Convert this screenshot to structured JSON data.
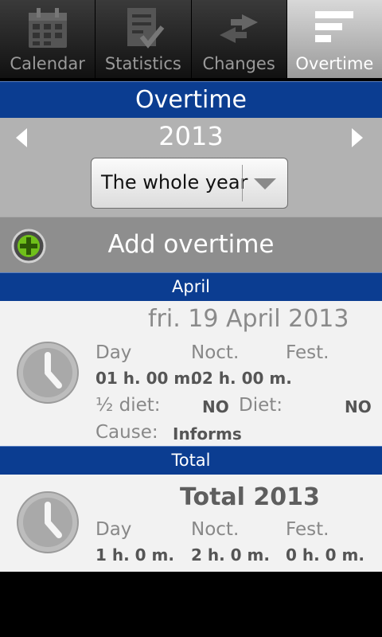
{
  "tabs": [
    {
      "label": "Calendar",
      "icon": "calendar-icon",
      "active": false
    },
    {
      "label": "Statistics",
      "icon": "statistics-icon",
      "active": false
    },
    {
      "label": "Changes",
      "icon": "changes-icon",
      "active": false
    },
    {
      "label": "Overtime",
      "icon": "overtime-icon",
      "active": true
    }
  ],
  "header": {
    "title": "Overtime"
  },
  "period": {
    "year": "2013",
    "selection": "The whole year"
  },
  "add": {
    "label": "Add overtime"
  },
  "month_section": {
    "title": "April",
    "entries": [
      {
        "date": "fri. 19 April 2013",
        "day_label": "Day",
        "noct_label": "Noct.",
        "fest_label": "Fest.",
        "day_value": "01 h. 00 m.",
        "noct_value": "02 h. 00 m.",
        "half_diet_label": "½ diet:",
        "half_diet_value": "NO",
        "diet_label": "Diet:",
        "diet_value": "NO",
        "cause_label": "Cause:",
        "cause_value": "Informs"
      }
    ]
  },
  "total_section": {
    "title": "Total",
    "heading": "Total 2013",
    "day_label": "Day",
    "noct_label": "Noct.",
    "fest_label": "Fest.",
    "day_value": "1 h. 0 m.",
    "noct_value": "2 h. 0 m.",
    "fest_value": "0 h. 0 m."
  },
  "colors": {
    "accent_blue": "#0b3d91",
    "add_green": "#6fbf1a"
  }
}
